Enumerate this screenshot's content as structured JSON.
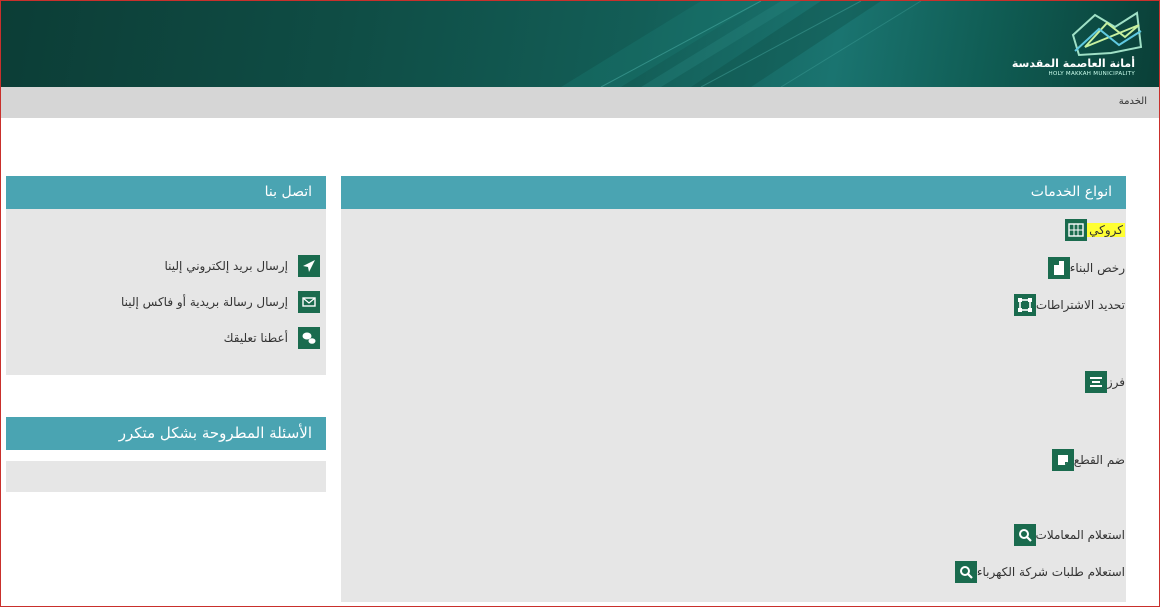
{
  "header": {
    "logo_ar": "أمانة العاصمة المقدسة",
    "logo_en": "HOLY MAKKAH MUNICIPALITY"
  },
  "breadcrumb": {
    "current": "الخدمة"
  },
  "services_panel": {
    "title": "انواع الخدمات",
    "items": [
      {
        "label": "كروكي",
        "icon": "map-grid-icon"
      },
      {
        "label": "رخص البناء",
        "icon": "building-icon"
      },
      {
        "label": "تحديد الاشتراطات",
        "icon": "square-corners-icon"
      },
      {
        "label": "فرز",
        "icon": "split-icon"
      },
      {
        "label": "ضم القطع",
        "icon": "merge-note-icon"
      },
      {
        "label": "استعلام المعاملات",
        "icon": "magnifier-icon"
      },
      {
        "label": "استعلام طلبات شركة الكهرباء",
        "icon": "magnifier-icon"
      }
    ]
  },
  "contact_panel": {
    "title": "اتصل بنا",
    "items": [
      {
        "label": "إرسال بريد إلكتروني إلينا",
        "icon": "paper-plane-icon"
      },
      {
        "label": "إرسال رسالة بريدية أو فاكس إلينا",
        "icon": "envelope-icon"
      },
      {
        "label": "أعطنا تعليقك",
        "icon": "comment-bubbles-icon"
      }
    ]
  },
  "faq_panel": {
    "title": "الأسئلة المطروحة بشكل متكرر"
  },
  "colors": {
    "panel_header": "#4aa4b2",
    "panel_body": "#e6e6e6",
    "icon_bg": "#1a6b4e",
    "highlight": "#ffff33"
  }
}
